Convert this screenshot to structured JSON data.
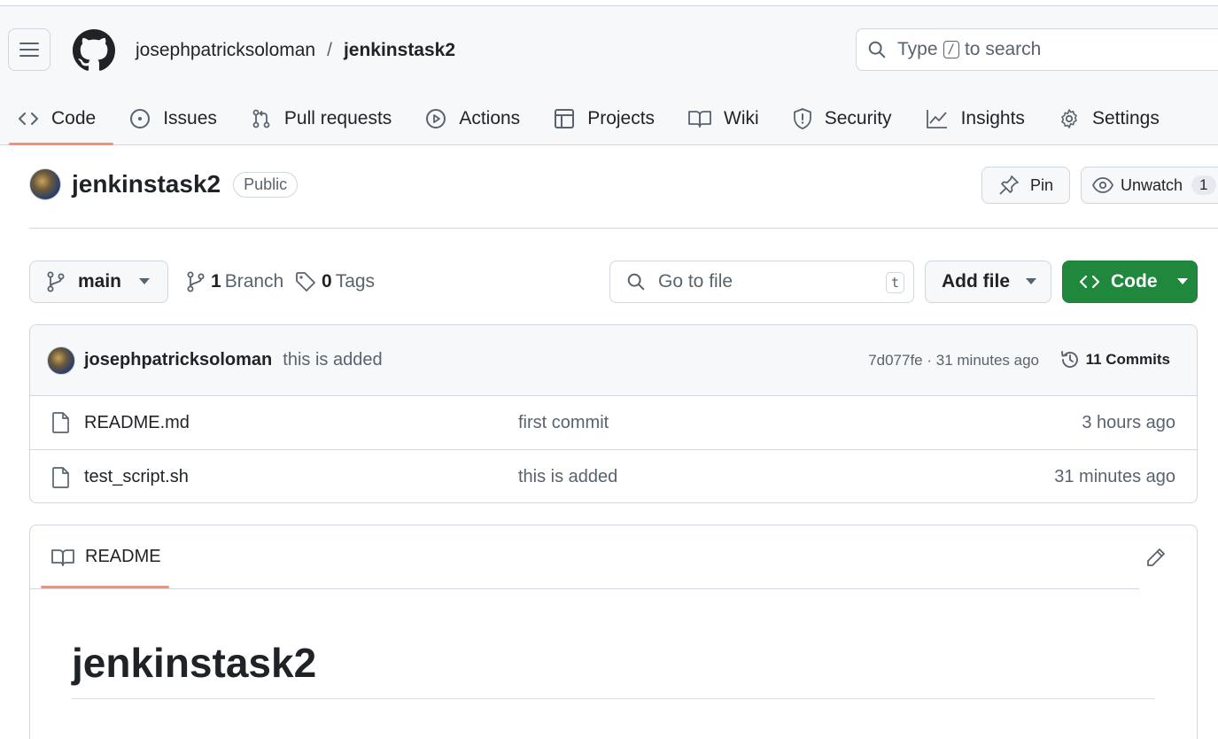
{
  "header": {
    "owner": "josephpatricksoloman",
    "separator": "/",
    "repo": "jenkinstask2",
    "search": {
      "prefix": "Type",
      "key": "/",
      "suffix": "to search"
    }
  },
  "tabs": [
    {
      "label": "Code",
      "icon": "code-icon",
      "active": true
    },
    {
      "label": "Issues",
      "icon": "issue-icon"
    },
    {
      "label": "Pull requests",
      "icon": "pull-request-icon"
    },
    {
      "label": "Actions",
      "icon": "play-icon"
    },
    {
      "label": "Projects",
      "icon": "table-icon"
    },
    {
      "label": "Wiki",
      "icon": "book-icon"
    },
    {
      "label": "Security",
      "icon": "shield-icon"
    },
    {
      "label": "Insights",
      "icon": "graph-icon"
    },
    {
      "label": "Settings",
      "icon": "gear-icon"
    }
  ],
  "repo_header": {
    "title": "jenkinstask2",
    "visibility": "Public",
    "pin_label": "Pin",
    "watch_label": "Unwatch",
    "watch_count": "1"
  },
  "branch_bar": {
    "branch": "main",
    "branch_count": "1",
    "branch_label": "Branch",
    "tag_count": "0",
    "tag_label": "Tags",
    "go_to_file_placeholder": "Go to file",
    "go_to_file_key": "t",
    "add_file_label": "Add file",
    "code_label": "Code"
  },
  "latest_commit": {
    "author": "josephpatricksoloman",
    "message": "this is added",
    "meta": "7d077fe · 31 minutes ago",
    "commits_label": "11 Commits"
  },
  "files": [
    {
      "name": "README.md",
      "message": "first commit",
      "time": "3 hours ago"
    },
    {
      "name": "test_script.sh",
      "message": "this is added",
      "time": "31 minutes ago"
    }
  ],
  "readme": {
    "tab_label": "README",
    "heading": "jenkinstask2"
  },
  "colors": {
    "accent_underline": "#fd8c73",
    "primary_button": "#1f883d",
    "border": "#d0d7de",
    "muted_text": "#59636e"
  }
}
